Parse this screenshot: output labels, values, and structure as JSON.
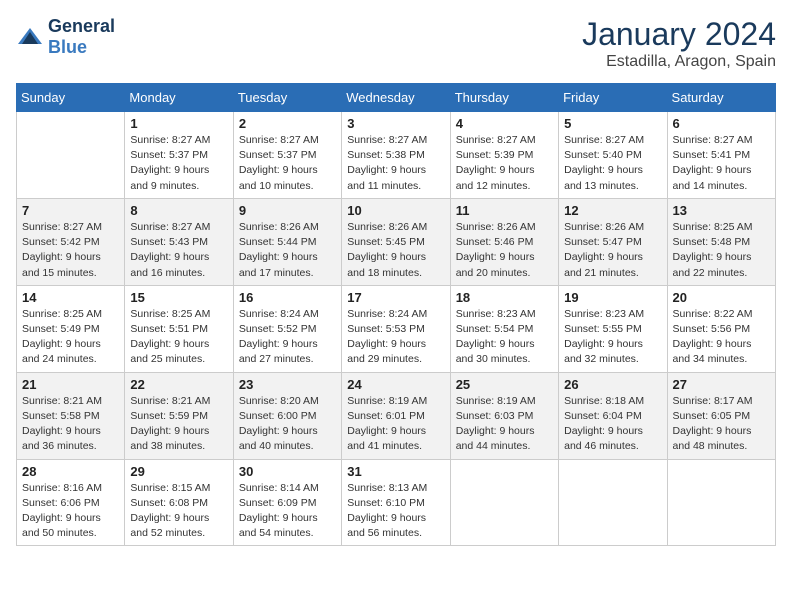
{
  "header": {
    "logo_general": "General",
    "logo_blue": "Blue",
    "month": "January 2024",
    "location": "Estadilla, Aragon, Spain"
  },
  "days_of_week": [
    "Sunday",
    "Monday",
    "Tuesday",
    "Wednesday",
    "Thursday",
    "Friday",
    "Saturday"
  ],
  "weeks": [
    [
      {
        "day": "",
        "sunrise": "",
        "sunset": "",
        "daylight": ""
      },
      {
        "day": "1",
        "sunrise": "Sunrise: 8:27 AM",
        "sunset": "Sunset: 5:37 PM",
        "daylight": "Daylight: 9 hours and 9 minutes."
      },
      {
        "day": "2",
        "sunrise": "Sunrise: 8:27 AM",
        "sunset": "Sunset: 5:37 PM",
        "daylight": "Daylight: 9 hours and 10 minutes."
      },
      {
        "day": "3",
        "sunrise": "Sunrise: 8:27 AM",
        "sunset": "Sunset: 5:38 PM",
        "daylight": "Daylight: 9 hours and 11 minutes."
      },
      {
        "day": "4",
        "sunrise": "Sunrise: 8:27 AM",
        "sunset": "Sunset: 5:39 PM",
        "daylight": "Daylight: 9 hours and 12 minutes."
      },
      {
        "day": "5",
        "sunrise": "Sunrise: 8:27 AM",
        "sunset": "Sunset: 5:40 PM",
        "daylight": "Daylight: 9 hours and 13 minutes."
      },
      {
        "day": "6",
        "sunrise": "Sunrise: 8:27 AM",
        "sunset": "Sunset: 5:41 PM",
        "daylight": "Daylight: 9 hours and 14 minutes."
      }
    ],
    [
      {
        "day": "7",
        "sunrise": "Sunrise: 8:27 AM",
        "sunset": "Sunset: 5:42 PM",
        "daylight": "Daylight: 9 hours and 15 minutes."
      },
      {
        "day": "8",
        "sunrise": "Sunrise: 8:27 AM",
        "sunset": "Sunset: 5:43 PM",
        "daylight": "Daylight: 9 hours and 16 minutes."
      },
      {
        "day": "9",
        "sunrise": "Sunrise: 8:26 AM",
        "sunset": "Sunset: 5:44 PM",
        "daylight": "Daylight: 9 hours and 17 minutes."
      },
      {
        "day": "10",
        "sunrise": "Sunrise: 8:26 AM",
        "sunset": "Sunset: 5:45 PM",
        "daylight": "Daylight: 9 hours and 18 minutes."
      },
      {
        "day": "11",
        "sunrise": "Sunrise: 8:26 AM",
        "sunset": "Sunset: 5:46 PM",
        "daylight": "Daylight: 9 hours and 20 minutes."
      },
      {
        "day": "12",
        "sunrise": "Sunrise: 8:26 AM",
        "sunset": "Sunset: 5:47 PM",
        "daylight": "Daylight: 9 hours and 21 minutes."
      },
      {
        "day": "13",
        "sunrise": "Sunrise: 8:25 AM",
        "sunset": "Sunset: 5:48 PM",
        "daylight": "Daylight: 9 hours and 22 minutes."
      }
    ],
    [
      {
        "day": "14",
        "sunrise": "Sunrise: 8:25 AM",
        "sunset": "Sunset: 5:49 PM",
        "daylight": "Daylight: 9 hours and 24 minutes."
      },
      {
        "day": "15",
        "sunrise": "Sunrise: 8:25 AM",
        "sunset": "Sunset: 5:51 PM",
        "daylight": "Daylight: 9 hours and 25 minutes."
      },
      {
        "day": "16",
        "sunrise": "Sunrise: 8:24 AM",
        "sunset": "Sunset: 5:52 PM",
        "daylight": "Daylight: 9 hours and 27 minutes."
      },
      {
        "day": "17",
        "sunrise": "Sunrise: 8:24 AM",
        "sunset": "Sunset: 5:53 PM",
        "daylight": "Daylight: 9 hours and 29 minutes."
      },
      {
        "day": "18",
        "sunrise": "Sunrise: 8:23 AM",
        "sunset": "Sunset: 5:54 PM",
        "daylight": "Daylight: 9 hours and 30 minutes."
      },
      {
        "day": "19",
        "sunrise": "Sunrise: 8:23 AM",
        "sunset": "Sunset: 5:55 PM",
        "daylight": "Daylight: 9 hours and 32 minutes."
      },
      {
        "day": "20",
        "sunrise": "Sunrise: 8:22 AM",
        "sunset": "Sunset: 5:56 PM",
        "daylight": "Daylight: 9 hours and 34 minutes."
      }
    ],
    [
      {
        "day": "21",
        "sunrise": "Sunrise: 8:21 AM",
        "sunset": "Sunset: 5:58 PM",
        "daylight": "Daylight: 9 hours and 36 minutes."
      },
      {
        "day": "22",
        "sunrise": "Sunrise: 8:21 AM",
        "sunset": "Sunset: 5:59 PM",
        "daylight": "Daylight: 9 hours and 38 minutes."
      },
      {
        "day": "23",
        "sunrise": "Sunrise: 8:20 AM",
        "sunset": "Sunset: 6:00 PM",
        "daylight": "Daylight: 9 hours and 40 minutes."
      },
      {
        "day": "24",
        "sunrise": "Sunrise: 8:19 AM",
        "sunset": "Sunset: 6:01 PM",
        "daylight": "Daylight: 9 hours and 41 minutes."
      },
      {
        "day": "25",
        "sunrise": "Sunrise: 8:19 AM",
        "sunset": "Sunset: 6:03 PM",
        "daylight": "Daylight: 9 hours and 44 minutes."
      },
      {
        "day": "26",
        "sunrise": "Sunrise: 8:18 AM",
        "sunset": "Sunset: 6:04 PM",
        "daylight": "Daylight: 9 hours and 46 minutes."
      },
      {
        "day": "27",
        "sunrise": "Sunrise: 8:17 AM",
        "sunset": "Sunset: 6:05 PM",
        "daylight": "Daylight: 9 hours and 48 minutes."
      }
    ],
    [
      {
        "day": "28",
        "sunrise": "Sunrise: 8:16 AM",
        "sunset": "Sunset: 6:06 PM",
        "daylight": "Daylight: 9 hours and 50 minutes."
      },
      {
        "day": "29",
        "sunrise": "Sunrise: 8:15 AM",
        "sunset": "Sunset: 6:08 PM",
        "daylight": "Daylight: 9 hours and 52 minutes."
      },
      {
        "day": "30",
        "sunrise": "Sunrise: 8:14 AM",
        "sunset": "Sunset: 6:09 PM",
        "daylight": "Daylight: 9 hours and 54 minutes."
      },
      {
        "day": "31",
        "sunrise": "Sunrise: 8:13 AM",
        "sunset": "Sunset: 6:10 PM",
        "daylight": "Daylight: 9 hours and 56 minutes."
      },
      {
        "day": "",
        "sunrise": "",
        "sunset": "",
        "daylight": ""
      },
      {
        "day": "",
        "sunrise": "",
        "sunset": "",
        "daylight": ""
      },
      {
        "day": "",
        "sunrise": "",
        "sunset": "",
        "daylight": ""
      }
    ]
  ]
}
